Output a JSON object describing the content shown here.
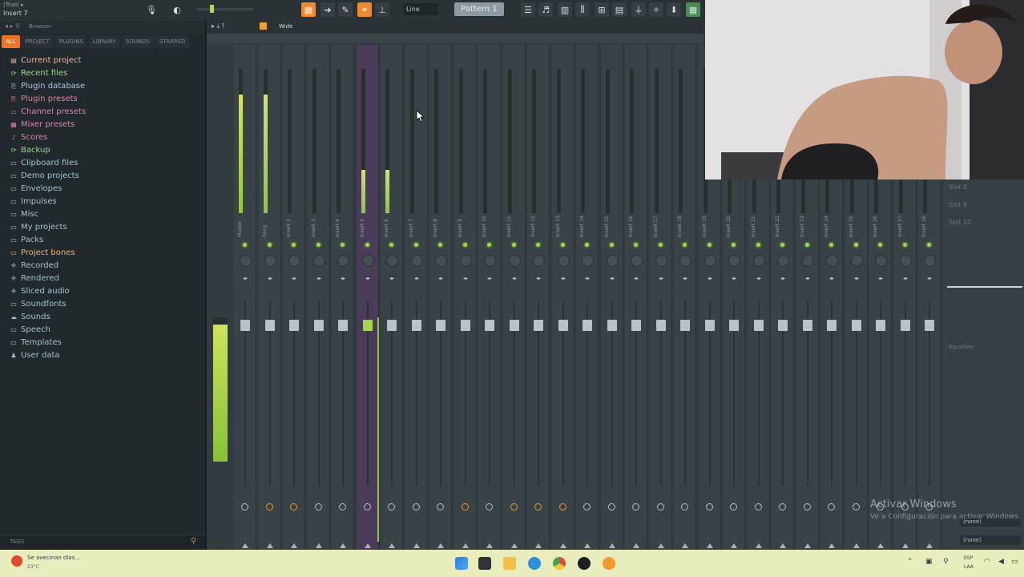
{
  "topbar": {
    "hint_line1": "(Trial) ▸",
    "hint_line2": "Insert 7",
    "line_mode": "Line",
    "pattern": "Pattern 1"
  },
  "browser": {
    "title": "Browser",
    "tabs": [
      "ALL",
      "PROJECT",
      "PLUGINS",
      "LIBRARY",
      "SOUNDS",
      "STARRED"
    ],
    "items": [
      {
        "label": "Current project",
        "color": "#e6b8a6",
        "icon": "▤"
      },
      {
        "label": "Recent files",
        "color": "#8fe07a",
        "icon": "⟳"
      },
      {
        "label": "Plugin database",
        "color": "#a9c4f0",
        "icon": "⎘"
      },
      {
        "label": "Plugin presets",
        "color": "#e47fb1",
        "icon": "⎘"
      },
      {
        "label": "Channel presets",
        "color": "#e47fb1",
        "icon": "▭"
      },
      {
        "label": "Mixer presets",
        "color": "#e47fb1",
        "icon": "▦"
      },
      {
        "label": "Scores",
        "color": "#e47fb1",
        "icon": "♪"
      },
      {
        "label": "Backup",
        "color": "#8fe07a",
        "icon": "⟳"
      },
      {
        "label": "Clipboard files",
        "color": "#9ec2d6",
        "icon": "▭"
      },
      {
        "label": "Demo projects",
        "color": "#9ec2d6",
        "icon": "▭"
      },
      {
        "label": "Envelopes",
        "color": "#9ec2d6",
        "icon": "▭"
      },
      {
        "label": "Impulses",
        "color": "#9ec2d6",
        "icon": "▭"
      },
      {
        "label": "Misc",
        "color": "#9ec2d6",
        "icon": "▭"
      },
      {
        "label": "My projects",
        "color": "#9ec2d6",
        "icon": "▭"
      },
      {
        "label": "Packs",
        "color": "#9ec2d6",
        "icon": "▭"
      },
      {
        "label": "Project bones",
        "color": "#f0b36a",
        "icon": "▭"
      },
      {
        "label": "Recorded",
        "color": "#9ec2d6",
        "icon": "✛"
      },
      {
        "label": "Rendered",
        "color": "#9ec2d6",
        "icon": "✛"
      },
      {
        "label": "Sliced audio",
        "color": "#9ec2d6",
        "icon": "✛"
      },
      {
        "label": "Soundfonts",
        "color": "#9ec2d6",
        "icon": "▭"
      },
      {
        "label": "Sounds",
        "color": "#9ec2d6",
        "icon": "☁"
      },
      {
        "label": "Speech",
        "color": "#9ec2d6",
        "icon": "▭"
      },
      {
        "label": "Templates",
        "color": "#9ec2d6",
        "icon": "▭"
      },
      {
        "label": "User data",
        "color": "#9ec2d6",
        "icon": "♟"
      }
    ],
    "tags_label": "TAGS"
  },
  "mixer": {
    "mode": "Wide",
    "tracks": [
      {
        "label": "Master",
        "meter": 0.82
      },
      {
        "label": "Song",
        "meter": 0.82
      },
      {
        "label": "Insert 2",
        "meter": 0
      },
      {
        "label": "Insert 3",
        "meter": 0
      },
      {
        "label": "Insert 4",
        "meter": 0
      },
      {
        "label": "Insert 5",
        "meter": 0.3
      },
      {
        "label": "Insert 6",
        "meter": 0.3
      },
      {
        "label": "Insert 7",
        "meter": 0
      },
      {
        "label": "Insert 8",
        "meter": 0
      },
      {
        "label": "Insert 9",
        "meter": 0
      },
      {
        "label": "Insert 10",
        "meter": 0
      },
      {
        "label": "Insert 11",
        "meter": 0
      },
      {
        "label": "Insert 12",
        "meter": 0
      },
      {
        "label": "Insert 13",
        "meter": 0
      },
      {
        "label": "Insert 14",
        "meter": 0
      },
      {
        "label": "Insert 15",
        "meter": 0
      },
      {
        "label": "Insert 16",
        "meter": 0
      },
      {
        "label": "Insert 17",
        "meter": 0
      },
      {
        "label": "Insert 18",
        "meter": 0
      },
      {
        "label": "Insert 19",
        "meter": 0
      },
      {
        "label": "Insert 20",
        "meter": 0
      },
      {
        "label": "Insert 21",
        "meter": 0
      },
      {
        "label": "Insert 22",
        "meter": 0
      },
      {
        "label": "Insert 23",
        "meter": 0
      },
      {
        "label": "Insert 24",
        "meter": 0
      },
      {
        "label": "Insert 25",
        "meter": 0
      },
      {
        "label": "Insert 26",
        "meter": 0
      },
      {
        "label": "Insert 27",
        "meter": 0
      },
      {
        "label": "Insert 28",
        "meter": 0
      }
    ],
    "selected_index": 5,
    "master_level": 0.95
  },
  "right_panel": {
    "slots": [
      "Slot 8",
      "Slot 9",
      "Slot 10"
    ],
    "eq_label": "Equalizer",
    "none1": "(none)",
    "none2": "(none)"
  },
  "watermark": {
    "line1": "Activar Windows",
    "line2": "Ve a Configuración para activar Windows."
  },
  "taskbar": {
    "weather_line1": "Se avecinan días...",
    "weather_line2": "23°C",
    "lang_line1": "ESP",
    "lang_line2": "LAA"
  }
}
